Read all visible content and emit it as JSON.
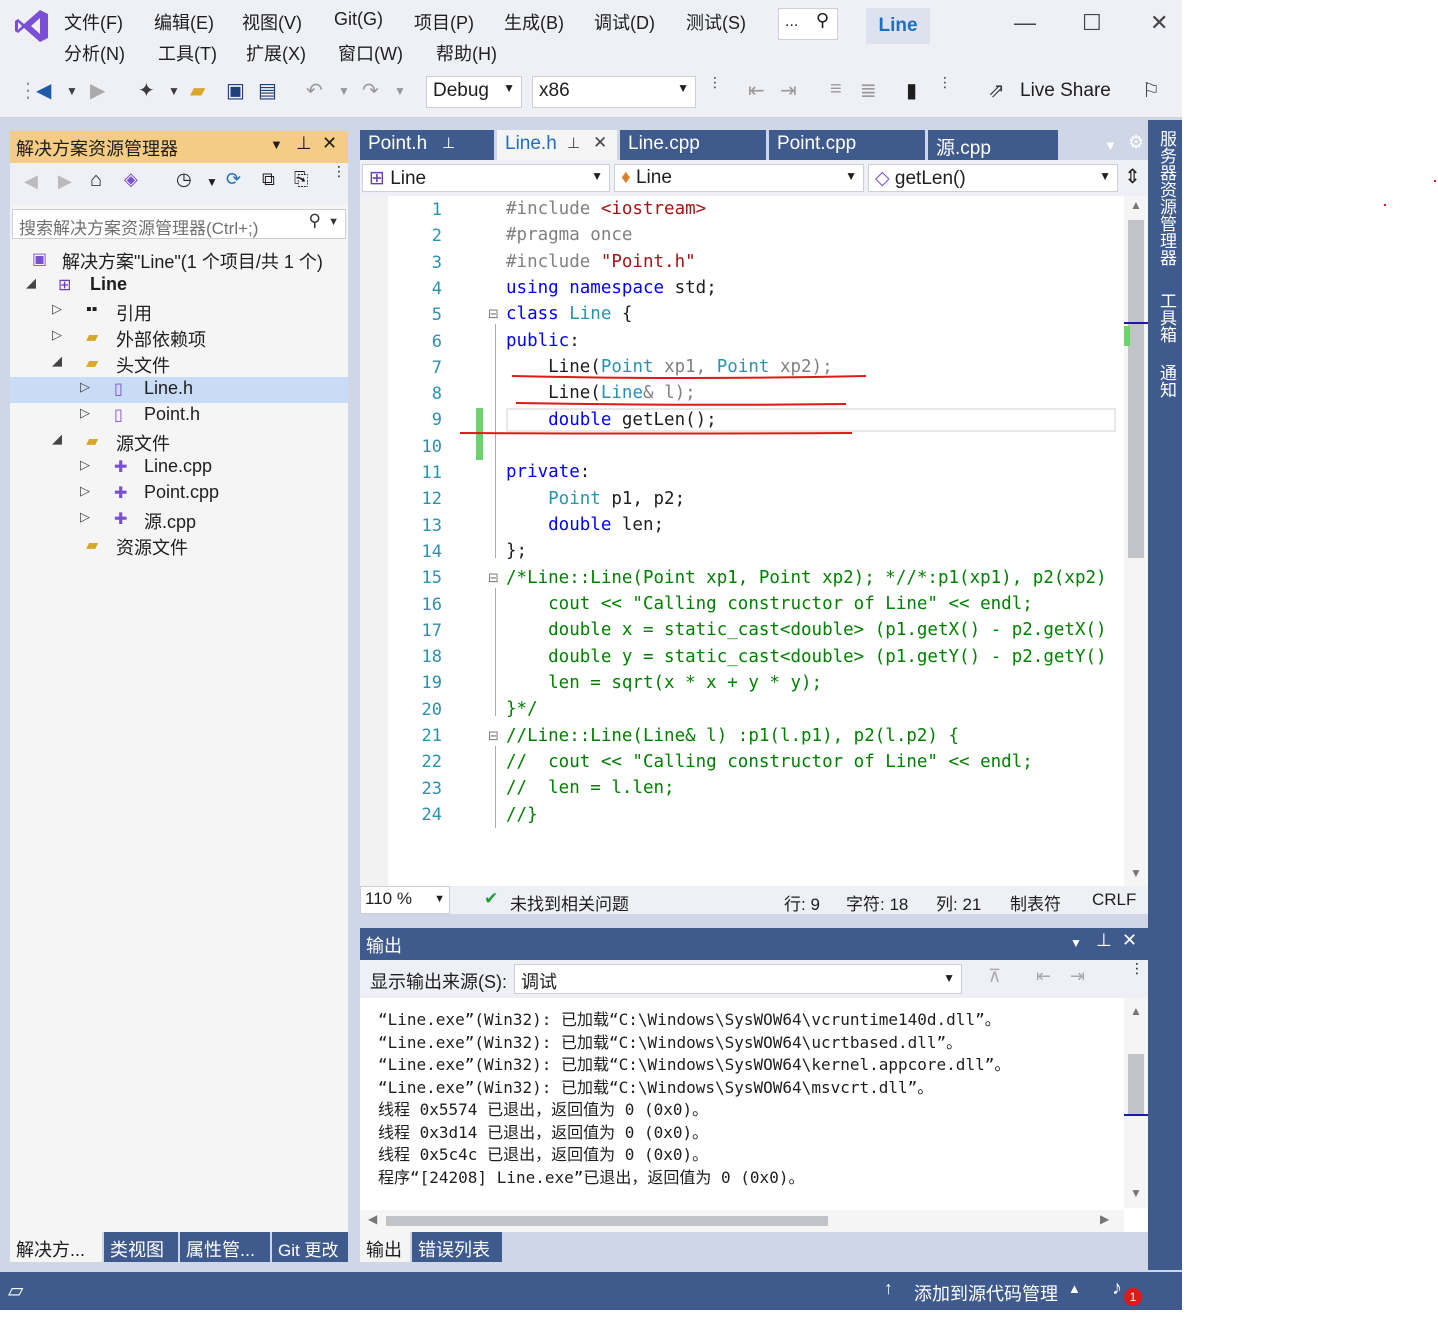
{
  "menu": [
    "文件(F)",
    "编辑(E)",
    "视图(V)",
    "Git(G)",
    "项目(P)",
    "生成(B)",
    "调试(D)",
    "测试(S)",
    "分析(N)",
    "工具(T)",
    "扩展(X)",
    "窗口(W)",
    "帮助(H)"
  ],
  "search_placeholder": "...",
  "window_title": "Line",
  "toolbar": {
    "config": "Debug",
    "platform": "x86",
    "live_share": "Live Share"
  },
  "solution": {
    "title": "解决方案资源管理器",
    "search_placeholder": "搜索解决方案资源管理器(Ctrl+;)",
    "root": "解决方案\"Line\"(1 个项目/共 1 个)",
    "project": "Line",
    "items": [
      "引用",
      "外部依赖项",
      "头文件",
      "Line.h",
      "Point.h",
      "源文件",
      "Line.cpp",
      "Point.cpp",
      "源.cpp",
      "资源文件"
    ],
    "tabs": [
      "解决方...",
      "类视图",
      "属性管...",
      "Git 更改"
    ]
  },
  "editor": {
    "tabs": [
      "Point.h",
      "Line.h",
      "Line.cpp",
      "Point.cpp",
      "源.cpp"
    ],
    "nav": [
      "Line",
      "Line",
      "getLen()"
    ],
    "line_numbers": [
      "1",
      "2",
      "3",
      "4",
      "5",
      "6",
      "7",
      "8",
      "9",
      "10",
      "11",
      "12",
      "13",
      "14",
      "15",
      "16",
      "17",
      "18",
      "19",
      "20",
      "21",
      "22",
      "23",
      "24"
    ],
    "code": {
      "l1a": "#include ",
      "l1b": "<iostream>",
      "l2": "#pragma once",
      "l3a": "#include ",
      "l3b": "\"Point.h\"",
      "l4a": "using",
      "l4b": " namespace",
      "l4c": " std;",
      "l5a": "class",
      "l5b": " Line",
      "l5c": " {",
      "l6a": "public",
      "l6b": ":",
      "l7a": "    Line",
      "l7b": "(",
      "l7c": "Point",
      "l7d": " xp1, ",
      "l7e": "Point",
      "l7f": " xp2);",
      "l8a": "    Line",
      "l8b": "(",
      "l8c": "Line",
      "l8d": "& l);",
      "l9a": "    double",
      "l9b": " getLen();",
      "l11a": "private",
      "l11b": ":",
      "l12a": "    Point",
      "l12b": " p1, p2;",
      "l13a": "    double",
      "l13b": " len;",
      "l14": "};",
      "l15": "/*Line::Line(Point xp1, Point xp2); *//*:p1(xp1), p2(xp2)",
      "l16": "    cout << \"Calling constructor of Line\" << endl;",
      "l17": "    double x = static_cast<double> (p1.getX() - p2.getX()",
      "l18": "    double y = static_cast<double> (p1.getY() - p2.getY()",
      "l19": "    len = sqrt(x * x + y * y);",
      "l20": "}*/",
      "l21": "//Line::Line(Line& l) :p1(l.p1), p2(l.p2) {",
      "l22": "//  cout << \"Calling constructor of Line\" << endl;",
      "l23": "//  len = l.len;",
      "l24": "//}"
    },
    "zoom": "110 %",
    "issues": "未找到相关问题",
    "row": "行: 9",
    "char": "字符: 18",
    "col": "列: 21",
    "indent": "制表符",
    "eol": "CRLF"
  },
  "output": {
    "title": "输出",
    "source_label": "显示输出来源(S):",
    "source_value": "调试",
    "lines": [
      "“Line.exe”(Win32): 已加载“C:\\Windows\\SysWOW64\\vcruntime140d.dll”。",
      "“Line.exe”(Win32): 已加载“C:\\Windows\\SysWOW64\\ucrtbased.dll”。",
      "“Line.exe”(Win32): 已加载“C:\\Windows\\SysWOW64\\kernel.appcore.dll”。",
      "“Line.exe”(Win32): 已加载“C:\\Windows\\SysWOW64\\msvcrt.dll”。",
      "线程 0x5574 已退出，返回值为 0 (0x0)。",
      "线程 0x3d14 已退出，返回值为 0 (0x0)。",
      "线程 0x5c4c 已退出，返回值为 0 (0x0)。",
      "程序“[24208] Line.exe”已退出，返回值为 0 (0x0)。"
    ],
    "tabs": [
      "输出",
      "错误列表"
    ]
  },
  "rail": [
    "服务器资源管理器",
    "工具箱",
    "通知"
  ],
  "status": {
    "source_control": "添加到源代码管理",
    "notifications": "1"
  },
  "colors": {
    "accent": "#3f5a8c",
    "annotation": "#e01818",
    "change_bar": "#6cd36c"
  }
}
